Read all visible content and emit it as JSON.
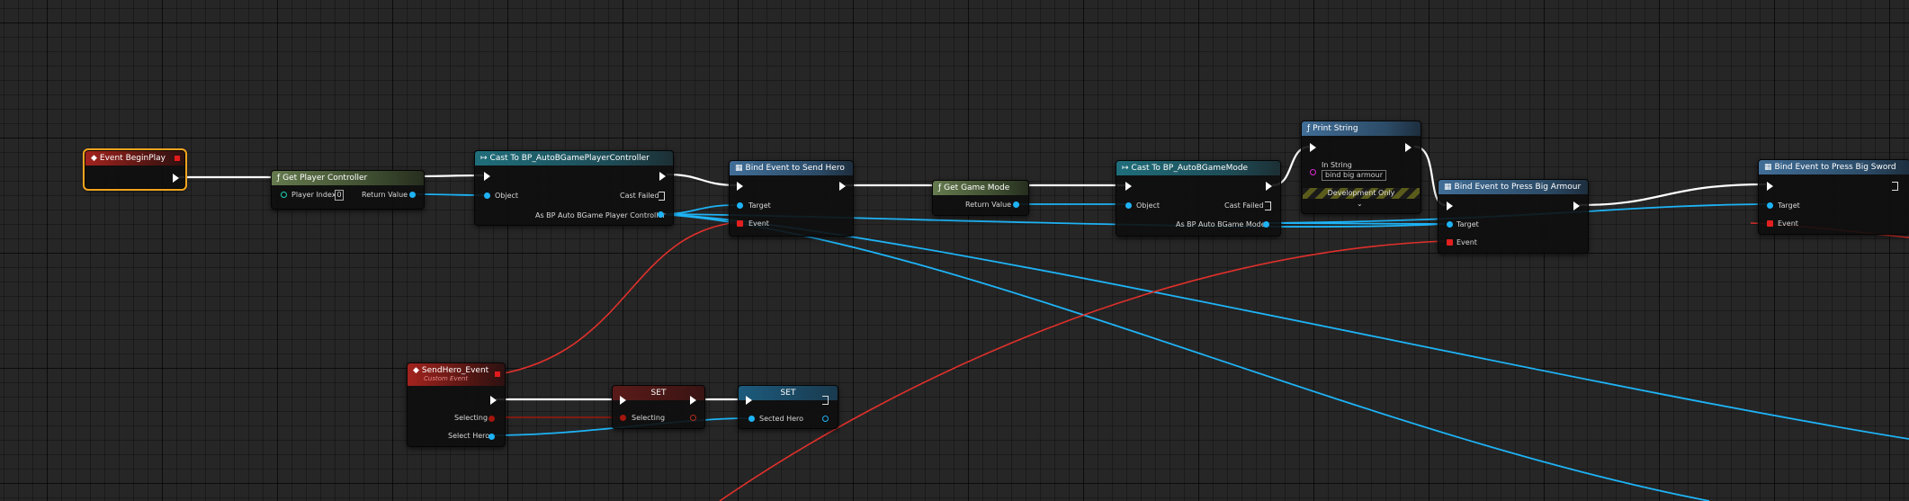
{
  "nodes": {
    "event_begin_play": {
      "title": "Event BeginPlay"
    },
    "get_player_controller": {
      "title": "Get Player Controller",
      "player_index_label": "Player Index",
      "player_index_value": "0",
      "return_value": "Return Value"
    },
    "cast_player_controller": {
      "title": "Cast To BP_AutoBGamePlayerController",
      "object": "Object",
      "cast_failed": "Cast Failed",
      "as_output": "As BP Auto BGame Player Controller"
    },
    "bind_send_hero": {
      "title": "Bind Event to Send Hero",
      "target": "Target",
      "event": "Event"
    },
    "get_game_mode": {
      "title": "Get Game Mode",
      "return_value": "Return Value"
    },
    "cast_game_mode": {
      "title": "Cast To BP_AutoBGameMode",
      "object": "Object",
      "cast_failed": "Cast Failed",
      "as_output": "As BP Auto BGame Mode"
    },
    "print_string": {
      "title": "Print String",
      "in_string_label": "In String",
      "in_string_value": "bind big armour",
      "dev_only": "Development Only",
      "expand": "⌄"
    },
    "bind_press_big_armour": {
      "title": "Bind Event to Press Big Armour",
      "target": "Target",
      "event": "Event"
    },
    "bind_press_big_sword": {
      "title": "Bind Event to Press Big Sword",
      "target": "Target",
      "event": "Event"
    },
    "send_hero_event": {
      "title": "SendHero_Event",
      "subtitle": "Custom Event",
      "selecting": "Selecting",
      "select_hero": "Select Hero"
    },
    "set_selecting": {
      "title": "SET",
      "selecting": "Selecting"
    },
    "set_sected_hero": {
      "title": "SET",
      "sected_hero": "Sected Hero"
    }
  },
  "icons": {
    "event": "event-diamond-icon",
    "function": "function-f-icon",
    "cast": "cast-arrows-icon",
    "bind": "bind-grid-icon"
  },
  "colors": {
    "exec_wire": "#ffffff",
    "object_wire": "#1eb3f5",
    "delegate_wire": "#e0302b",
    "bool_wire": "#8b1a12",
    "event_header": "#a3231e",
    "pure_header": "#657a4e",
    "cast_header": "#1f6e7b",
    "call_header": "#416e97",
    "selection": "#f7a51e"
  }
}
